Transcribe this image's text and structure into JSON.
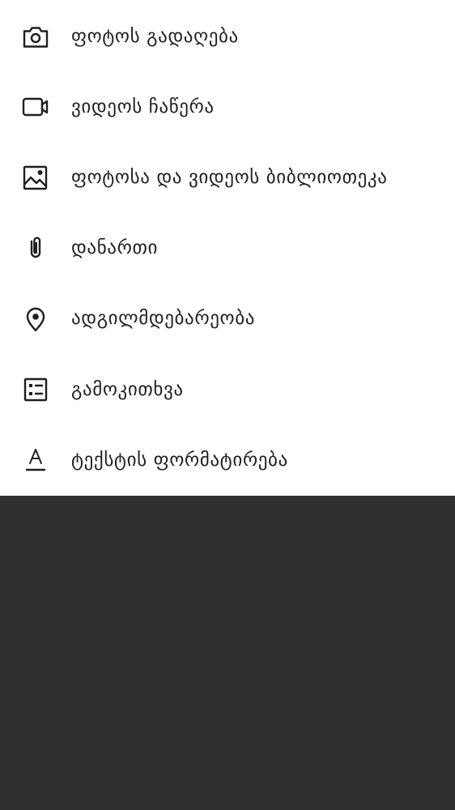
{
  "menu": {
    "items": [
      {
        "id": "take-photo",
        "label": "ფოტოს გადაღება",
        "icon": "camera-icon"
      },
      {
        "id": "record-video",
        "label": "ვიდეოს ჩაწერა",
        "icon": "video-icon"
      },
      {
        "id": "gallery",
        "label": "ფოტოსა და ვიდეოს ბიბლიოთეკა",
        "icon": "image-icon"
      },
      {
        "id": "attachment",
        "label": "დანართი",
        "icon": "paperclip-icon"
      },
      {
        "id": "location",
        "label": "ადგილმდებარეობა",
        "icon": "location-pin-icon"
      },
      {
        "id": "poll",
        "label": "გამოკითხვა",
        "icon": "poll-list-icon"
      },
      {
        "id": "text-format",
        "label": "ტექსტის ფორმატირება",
        "icon": "text-format-icon"
      }
    ]
  },
  "colors": {
    "sheet_background": "#ffffff",
    "scrim": "#303030",
    "text": "#1f1f1f"
  }
}
